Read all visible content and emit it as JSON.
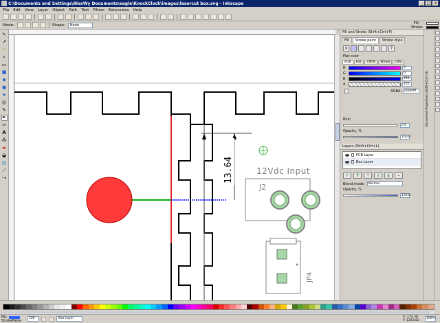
{
  "window": {
    "title": "C:\\Documents and Settings\\AlexWy Documents\\eagle\\KnockClock\\images\\lasercut box.svg - Inkscape",
    "controls": [
      "_",
      "□",
      "×"
    ]
  },
  "menu": [
    "File",
    "Edit",
    "View",
    "Layer",
    "Object",
    "Path",
    "Text",
    "Filters",
    "Extensions",
    "Help"
  ],
  "tool_controls": {
    "mode_label": "Mode:",
    "shape_label": "Shape:",
    "shape_value": "None"
  },
  "indicator": {
    "fill_label": "Fill:",
    "stroke_label": "Stroke:",
    "fill_color": "#ffffff",
    "stroke_color": "#000000"
  },
  "canvas": {
    "dimension_label": "13.64",
    "connector_text": "12Vdc  Input",
    "ref_j2": "J2",
    "ref_jp4": "JP4"
  },
  "fill_stroke_panel": {
    "title": "Fill and Stroke (Shift+Ctrl+F)",
    "tabs": [
      "Fill",
      "Stroke paint",
      "Stroke style"
    ],
    "active_tab": "Stroke paint",
    "flat_color_label": "Flat color",
    "modes": [
      "RGB",
      "HSL",
      "CMYK",
      "Wheel",
      "CMS"
    ],
    "channels": [
      {
        "label": "R",
        "value": "0"
      },
      {
        "label": "G",
        "value": "0"
      },
      {
        "label": "B",
        "value": "255"
      },
      {
        "label": "A",
        "value": "255"
      }
    ],
    "rgba_label": "RGBA:",
    "rgba_value": "0000ffff",
    "blur_label": "Blur:",
    "blur_value": "0.0",
    "opacity_label": "Opacity, %",
    "opacity_value": "100.0"
  },
  "layers_panel": {
    "title": "Layers (Shift+Ctrl+L)",
    "layers": [
      {
        "name": "PCB Layer"
      },
      {
        "name": "Box Layer"
      }
    ],
    "blend_label": "Blend mode:",
    "blend_value": "Normal",
    "opacity_label": "Opacity, %",
    "opacity_value": "100.0"
  },
  "side_tab_label": "Document Properties (Shift+Ctrl+D)",
  "statusbar": {
    "fill_label": "Fill:",
    "stroke_label": "Stroke:",
    "stroke_value": "None",
    "opacity_value": "100",
    "layer_value": "Box Layer",
    "coords_x": "X: 172.38",
    "coords_y": "Y: 1263.82",
    "zoom": "100%"
  },
  "palette_colors": [
    "#000000",
    "#1a1a1a",
    "#333333",
    "#4d4d4d",
    "#666666",
    "#808080",
    "#999999",
    "#b3b3b3",
    "#cccccc",
    "#e6e6e6",
    "#f2f2f2",
    "#ffffff",
    "#800000",
    "#ff0000",
    "#ff6600",
    "#ff9900",
    "#ffcc00",
    "#ffff00",
    "#ccff00",
    "#99ff00",
    "#66ff00",
    "#00ff00",
    "#00ff66",
    "#00ff99",
    "#00ffcc",
    "#00ffff",
    "#00ccff",
    "#0099ff",
    "#0066ff",
    "#0000ff",
    "#6600ff",
    "#9900ff",
    "#cc00ff",
    "#ff00ff",
    "#ff00cc",
    "#ff0099",
    "#ff0066",
    "#d40000",
    "#ff2a2a",
    "#ff5555",
    "#ff8080",
    "#ffaaaa",
    "#ffd5d5",
    "#550000",
    "#aa0000",
    "#d45500",
    "#ff7f2a",
    "#ffb380",
    "#d4aa00",
    "#ffcc00",
    "#fff6d5",
    "#447821",
    "#5aa02c",
    "#89a02c",
    "#abc837",
    "#cdde87",
    "#2ca089",
    "#37c8ab",
    "#2c5aa0",
    "#3771c8",
    "#5f8dd3",
    "#87aade",
    "#0044aa",
    "#5500d4",
    "#8d5fd3",
    "#aa87de",
    "#c837ab",
    "#de87cd",
    "#a02c89",
    "#d35fbc",
    "#552200",
    "#803300",
    "#aa4400",
    "#c87137",
    "#d38d5f",
    "#deaa87"
  ]
}
